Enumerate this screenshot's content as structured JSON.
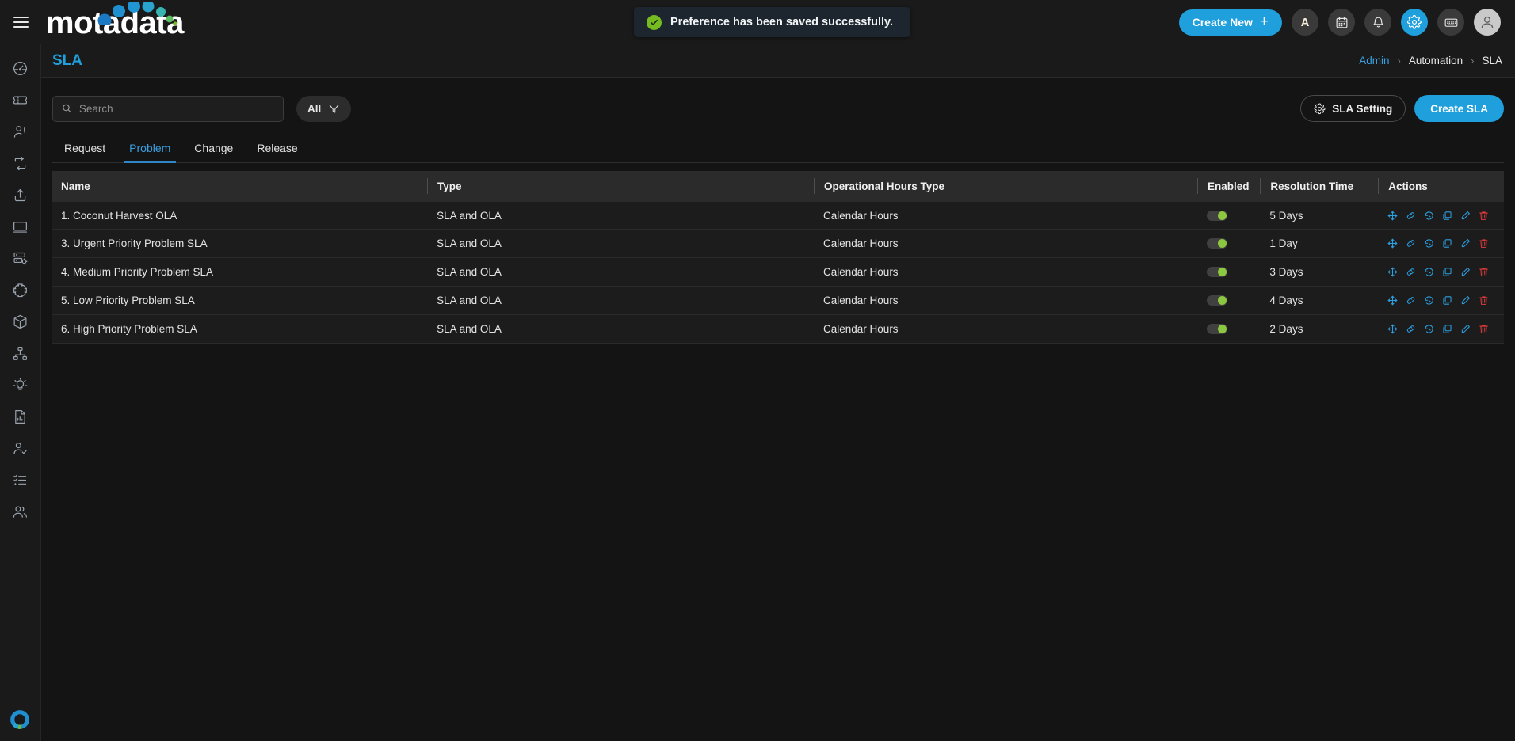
{
  "app": {
    "logo_text": "motadata",
    "brand_blue": "#1f9fdb",
    "brand_green": "#8dc63f",
    "danger_red": "#e03b3b"
  },
  "topbar": {
    "menu_icon": "hamburger-icon",
    "notification_banner": {
      "icon": "check-circle-icon",
      "message": "Preference has been saved successfully."
    },
    "create_new_label": "Create New",
    "create_new_plus": "+",
    "icons": [
      {
        "name": "assistant-icon",
        "glyph": "A",
        "active": false
      },
      {
        "name": "calendar-icon",
        "glyph": "",
        "active": false
      },
      {
        "name": "notifications-bell-icon",
        "glyph": "",
        "active": false
      },
      {
        "name": "settings-gear-icon",
        "glyph": "",
        "active": true
      },
      {
        "name": "keyboard-shortcuts-icon",
        "glyph": "",
        "active": false
      },
      {
        "name": "user-avatar-icon",
        "glyph": "",
        "active": false
      }
    ]
  },
  "sidebar": {
    "items": [
      {
        "name": "sidebar-item-dashboard",
        "icon": "gauge-icon"
      },
      {
        "name": "sidebar-item-tickets",
        "icon": "ticket-icon"
      },
      {
        "name": "sidebar-item-users",
        "icon": "user-icon"
      },
      {
        "name": "sidebar-item-workflow",
        "icon": "refresh-loop-icon"
      },
      {
        "name": "sidebar-item-release",
        "icon": "upload-share-icon"
      },
      {
        "name": "sidebar-item-assets",
        "icon": "monitor-icon"
      },
      {
        "name": "sidebar-item-servers",
        "icon": "server-settings-icon"
      },
      {
        "name": "sidebar-item-integrations",
        "icon": "puzzle-icon"
      },
      {
        "name": "sidebar-item-products",
        "icon": "cube-icon"
      },
      {
        "name": "sidebar-item-hierarchy",
        "icon": "org-chart-icon"
      },
      {
        "name": "sidebar-item-knowledge",
        "icon": "lightbulb-icon"
      },
      {
        "name": "sidebar-item-reports",
        "icon": "report-document-icon"
      },
      {
        "name": "sidebar-item-approvals",
        "icon": "user-check-icon"
      },
      {
        "name": "sidebar-item-tasks",
        "icon": "checklist-icon"
      },
      {
        "name": "sidebar-item-groups",
        "icon": "users-group-icon"
      }
    ],
    "bottom_logo": "motadata-ring-logo"
  },
  "page": {
    "title": "SLA",
    "breadcrumb": [
      {
        "label": "Admin",
        "link": true
      },
      {
        "label": "Automation",
        "link": false
      },
      {
        "label": "SLA",
        "link": false
      }
    ],
    "breadcrumb_separator": "›"
  },
  "toolbar": {
    "search_placeholder": "Search",
    "search_value": "",
    "search_icon": "search-icon",
    "filter_label": "All",
    "filter_icon": "funnel-icon",
    "sla_setting_label": "SLA Setting",
    "sla_setting_icon": "gear-icon",
    "create_sla_label": "Create SLA"
  },
  "tabs": [
    {
      "label": "Request",
      "active": false
    },
    {
      "label": "Problem",
      "active": true
    },
    {
      "label": "Change",
      "active": false
    },
    {
      "label": "Release",
      "active": false
    }
  ],
  "table": {
    "columns": [
      "Name",
      "Type",
      "Operational Hours Type",
      "Enabled",
      "Resolution Time",
      "Actions"
    ],
    "action_icons": [
      {
        "name": "move-icon",
        "color": "#2b9fe0"
      },
      {
        "name": "link-icon",
        "color": "#2b9fe0"
      },
      {
        "name": "history-icon",
        "color": "#2b9fe0"
      },
      {
        "name": "copy-icon",
        "color": "#2b9fe0"
      },
      {
        "name": "edit-pencil-icon",
        "color": "#2b9fe0"
      },
      {
        "name": "delete-trash-icon",
        "color": "#e03b3b"
      }
    ],
    "rows": [
      {
        "name": "1. Coconut Harvest OLA",
        "type": "SLA and OLA",
        "hours": "Calendar Hours",
        "enabled": true,
        "resolution": "5 Days"
      },
      {
        "name": "3. Urgent Priority Problem SLA",
        "type": "SLA and OLA",
        "hours": "Calendar Hours",
        "enabled": true,
        "resolution": "1 Day"
      },
      {
        "name": "4. Medium Priority Problem SLA",
        "type": "SLA and OLA",
        "hours": "Calendar Hours",
        "enabled": true,
        "resolution": "3 Days"
      },
      {
        "name": "5. Low Priority Problem SLA",
        "type": "SLA and OLA",
        "hours": "Calendar Hours",
        "enabled": true,
        "resolution": "4 Days"
      },
      {
        "name": "6. High Priority Problem SLA",
        "type": "SLA and OLA",
        "hours": "Calendar Hours",
        "enabled": true,
        "resolution": "2 Days"
      }
    ]
  }
}
